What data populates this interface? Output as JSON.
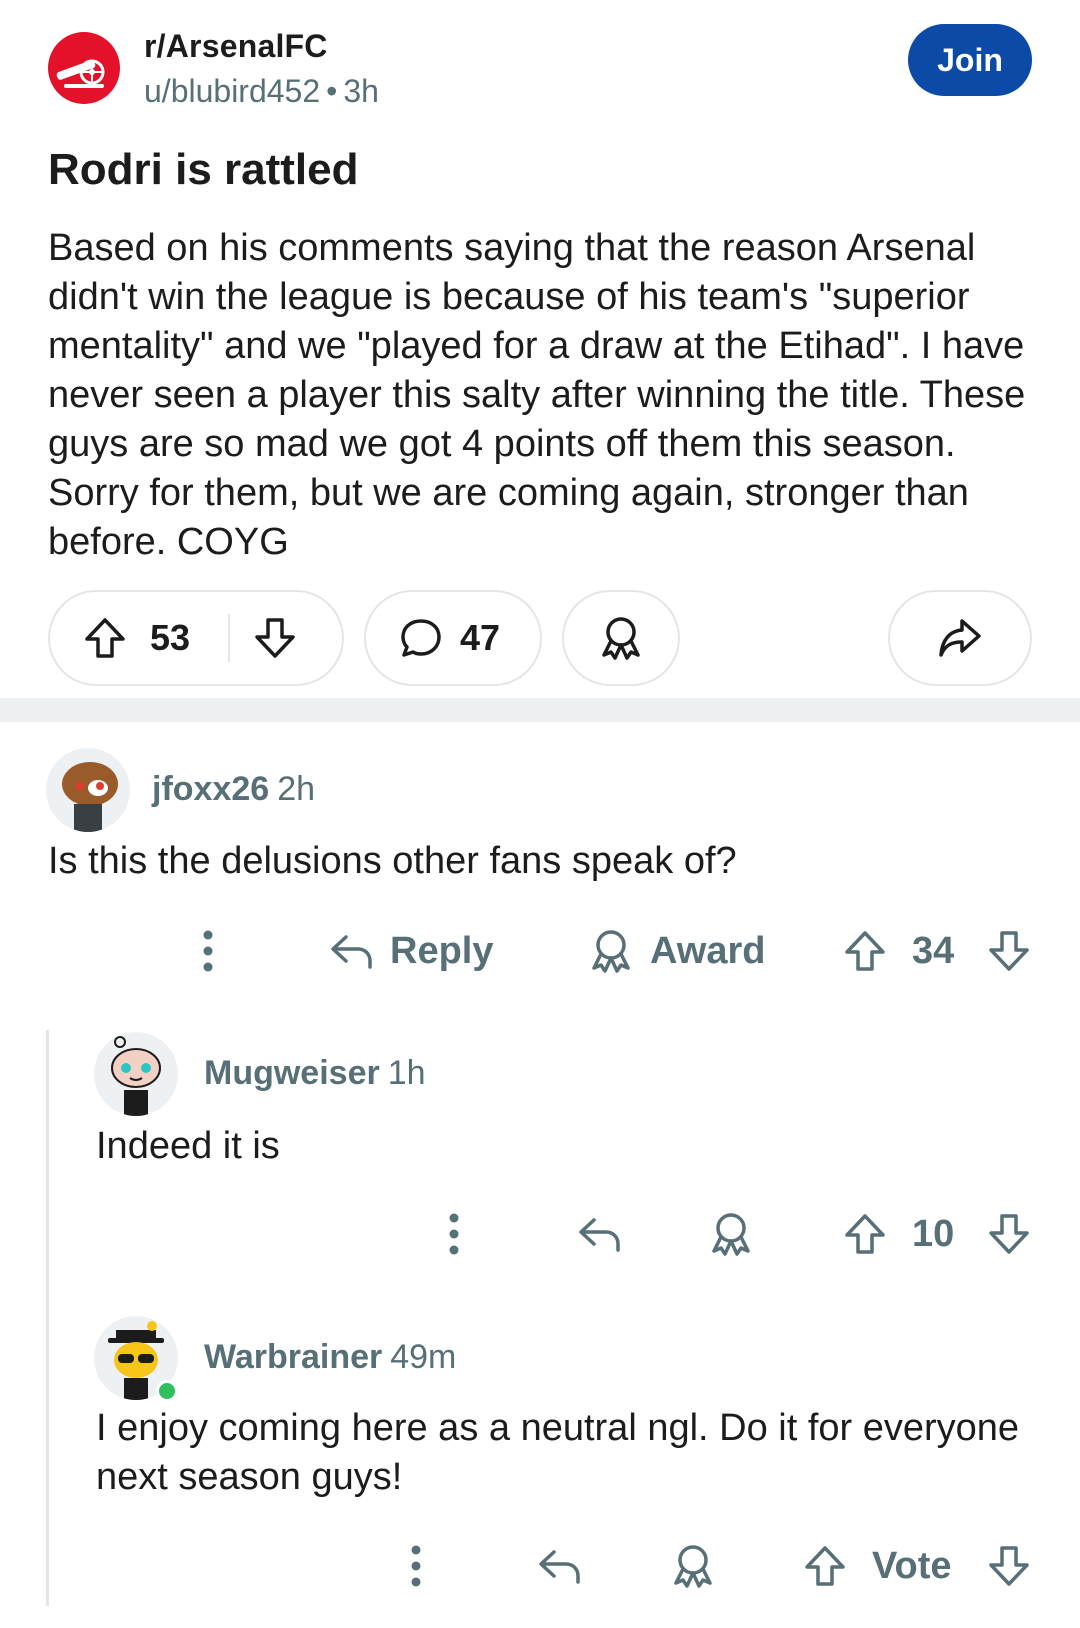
{
  "post": {
    "subreddit": "r/ArsenalFC",
    "author": "u/blubird452",
    "separator": "•",
    "age": "3h",
    "join_label": "Join",
    "title": "Rodri is rattled",
    "body": "Based on his comments saying that the reason Arsenal didn't win the league is because of his team's \"superior mentality\" and we \"played for a draw at the Etihad\". I have never seen a player this salty after winning the title. These guys are so mad we got 4 points off them this season. Sorry for them, but we are coming again, stronger than before. COYG",
    "upvotes": "53",
    "comments": "47"
  },
  "comments": [
    {
      "username": "jfoxx26",
      "age": "2h",
      "text": "Is this the delusions other fans speak of?",
      "reply_label": "Reply",
      "award_label": "Award",
      "votes": "34"
    },
    {
      "username": "Mugweiser",
      "age": "1h",
      "text": "Indeed it is",
      "votes": "10"
    },
    {
      "username": "Warbrainer",
      "age": "49m",
      "text": "I enjoy coming here as a neutral ngl. Do it for everyone next season guys!",
      "votes": "Vote"
    }
  ],
  "icons": {
    "upvote": "arrow-up-outline",
    "downvote": "arrow-down-outline",
    "comment": "speech-bubble",
    "award": "award-ribbon",
    "share": "share-arrow",
    "reply": "reply-arrow",
    "more": "vertical-ellipsis"
  },
  "colors": {
    "join_button": "#0b4aa6",
    "subreddit_avatar": "#e4112a",
    "muted_text": "#576f76",
    "online": "#2fbf5b"
  }
}
